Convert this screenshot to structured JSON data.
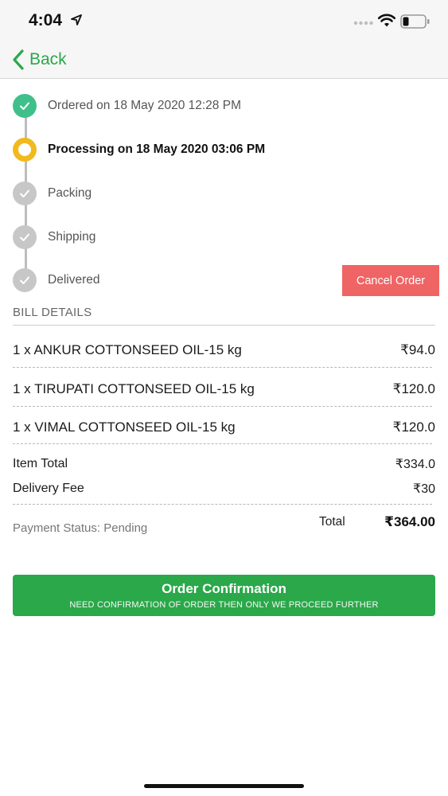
{
  "status_bar": {
    "time": "4:04"
  },
  "nav": {
    "back_label": "Back"
  },
  "timeline": {
    "steps": [
      {
        "label": "Ordered on 18 May 2020 12:28 PM",
        "state": "done"
      },
      {
        "label": "Processing on 18 May 2020 03:06 PM",
        "state": "current"
      },
      {
        "label": "Packing",
        "state": "pending"
      },
      {
        "label": "Shipping",
        "state": "pending"
      },
      {
        "label": "Delivered",
        "state": "pending"
      }
    ],
    "cancel_label": "Cancel Order"
  },
  "bill": {
    "header": "BILL DETAILS",
    "items": [
      {
        "name": "1 x ANKUR COTTONSEED OIL-15 kg",
        "price": "₹94.0"
      },
      {
        "name": "1 x TIRUPATI COTTONSEED OIL-15 kg",
        "price": "₹120.0"
      },
      {
        "name": "1 x VIMAL COTTONSEED OIL-15 kg",
        "price": "₹120.0"
      }
    ],
    "item_total_label": "Item Total",
    "item_total_value": "₹334.0",
    "delivery_fee_label": "Delivery Fee",
    "delivery_fee_value": "₹30",
    "payment_status": "Payment Status: Pending",
    "total_label": "Total",
    "total_value": "₹364.00"
  },
  "confirm": {
    "title": "Order Confirmation",
    "subtitle": "NEED CONFIRMATION OF ORDER THEN ONLY WE PROCEED FURTHER"
  },
  "colors": {
    "accent_green": "#2aa84a",
    "done_green": "#3fc08b",
    "current_yellow": "#f1b91d",
    "pending_gray": "#c7c7c7",
    "cancel_red": "#ef6464"
  },
  "icons": {
    "back": "chevron-left-icon",
    "step_done": "checkmark-icon",
    "step_current": "ring-icon",
    "wifi": "wifi-icon",
    "battery": "battery-icon",
    "location": "location-arrow-icon"
  }
}
